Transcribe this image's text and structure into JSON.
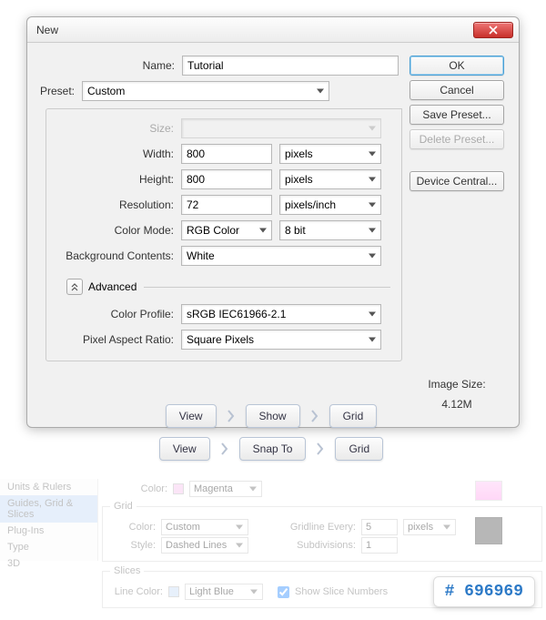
{
  "dialog": {
    "title": "New",
    "fields": {
      "name_label": "Name:",
      "name_value": "Tutorial",
      "preset_label": "Preset:",
      "preset_value": "Custom",
      "size_label": "Size:",
      "size_value": "",
      "width_label": "Width:",
      "width_value": "800",
      "width_unit": "pixels",
      "height_label": "Height:",
      "height_value": "800",
      "height_unit": "pixels",
      "resolution_label": "Resolution:",
      "resolution_value": "72",
      "resolution_unit": "pixels/inch",
      "colormode_label": "Color Mode:",
      "colormode_value": "RGB Color",
      "colormode_depth": "8 bit",
      "bg_label": "Background Contents:",
      "bg_value": "White",
      "advanced_label": "Advanced",
      "colorprofile_label": "Color Profile:",
      "colorprofile_value": "sRGB IEC61966-2.1",
      "pixelaspect_label": "Pixel Aspect Ratio:",
      "pixelaspect_value": "Square Pixels"
    },
    "buttons": {
      "ok": "OK",
      "cancel": "Cancel",
      "save_preset": "Save Preset...",
      "delete_preset": "Delete Preset...",
      "device_central": "Device Central..."
    },
    "image_size_label": "Image Size:",
    "image_size_value": "4.12M"
  },
  "breadcrumbs": {
    "row1": {
      "a": "View",
      "b": "Show",
      "c": "Grid"
    },
    "row2": {
      "a": "View",
      "b": "Snap To",
      "c": "Grid"
    }
  },
  "prefs": {
    "sidebar": {
      "item0": "Units & Rulers",
      "item1": "Guides, Grid & Slices",
      "item2": "Plug-Ins",
      "item3": "Type",
      "item4": "3D"
    },
    "top": {
      "color_label": "Color:",
      "color_value": "Magenta"
    },
    "grid": {
      "legend": "Grid",
      "color_label": "Color:",
      "color_value": "Custom",
      "style_label": "Style:",
      "style_value": "Dashed Lines",
      "gridline_label": "Gridline Every:",
      "gridline_value": "5",
      "gridline_unit": "pixels",
      "subdiv_label": "Subdivisions:",
      "subdiv_value": "1"
    },
    "slices": {
      "legend": "Slices",
      "linecolor_label": "Line Color:",
      "linecolor_value": "Light Blue",
      "show_numbers": "Show Slice Numbers"
    }
  },
  "hex": "# 696969"
}
